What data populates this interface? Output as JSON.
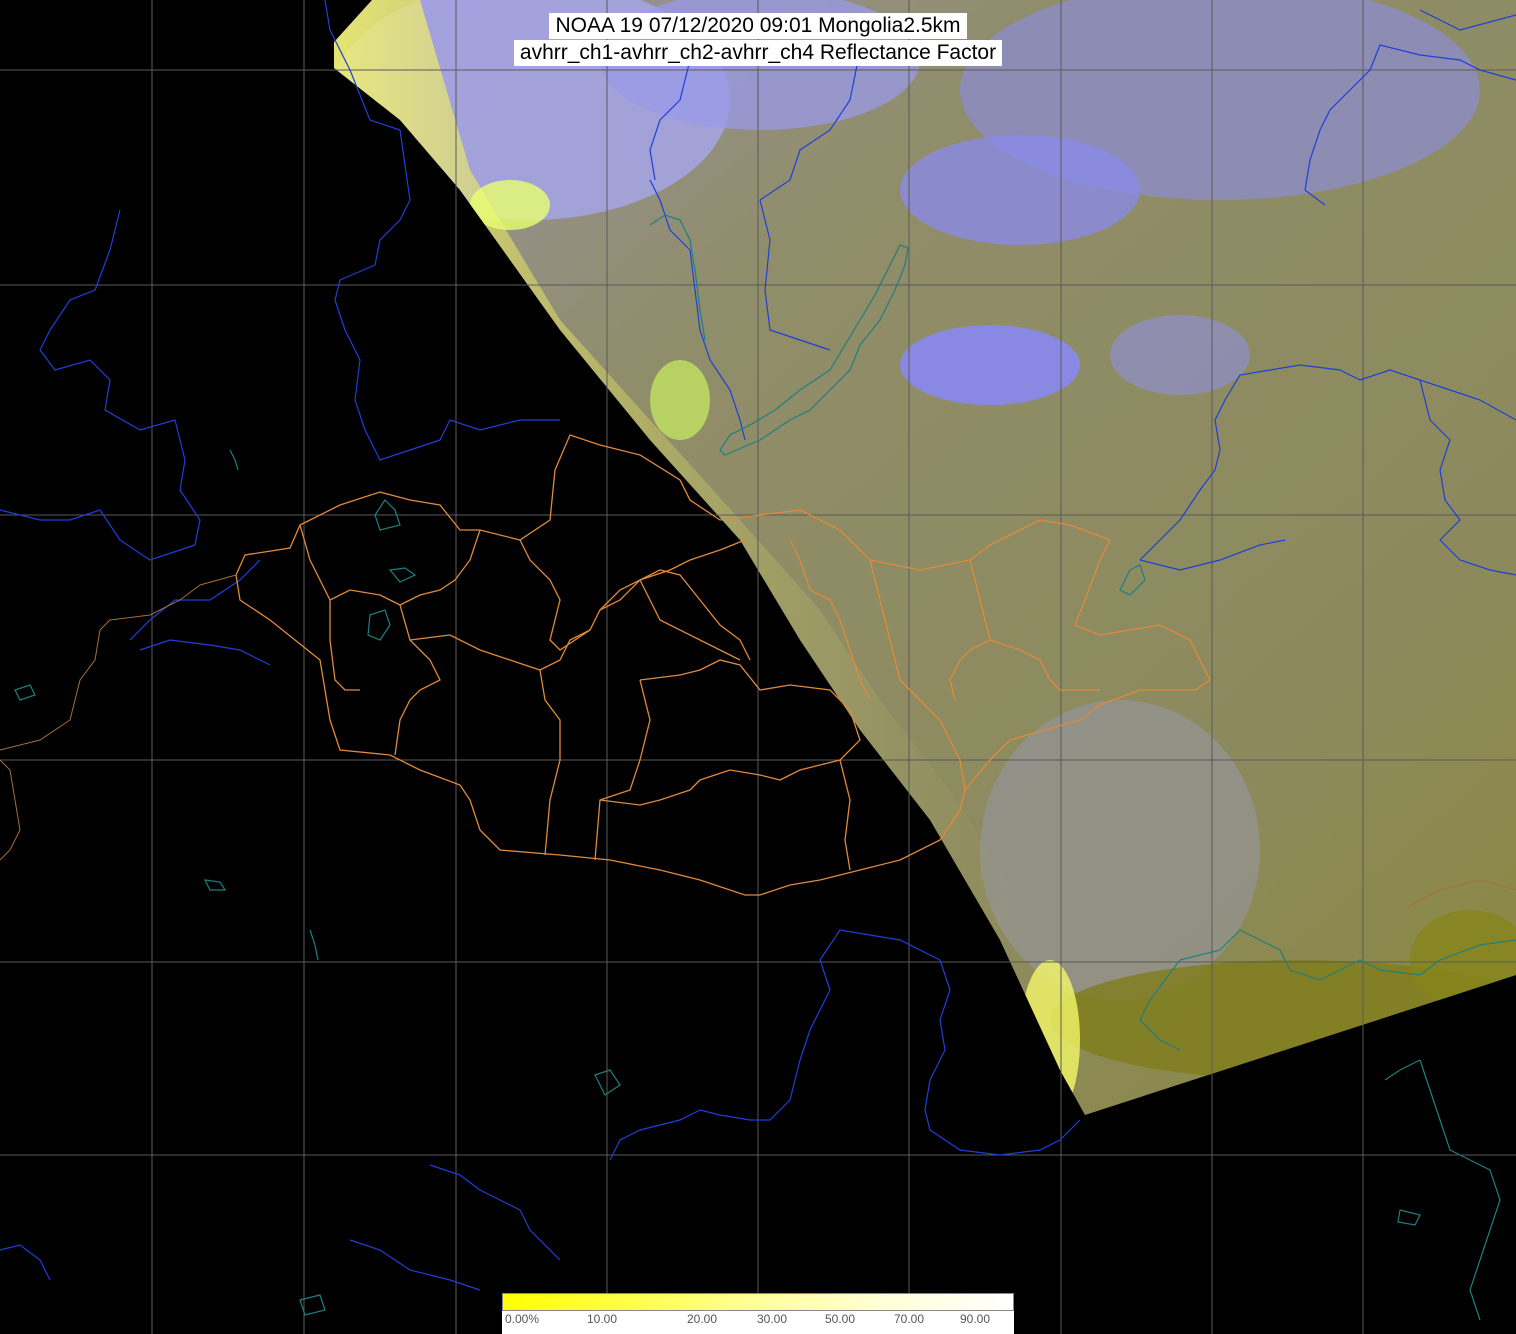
{
  "title": {
    "line1": "NOAA 19 07/12/2020 09:01 Mongolia2.5km",
    "line2": "avhrr_ch1-avhrr_ch2-avhrr_ch4 Reflectance Factor"
  },
  "colorbar": {
    "labels": [
      "0.00%",
      "10.00",
      "20.00",
      "30.00",
      "50.00",
      "70.00",
      "90.00"
    ],
    "colors": [
      "#ffff00",
      "#ffff4a",
      "#ffff9a",
      "#ffffd8",
      "#ffffff"
    ]
  },
  "colors": {
    "grid": "#5a5a5a",
    "rivers": "#1f3fd8",
    "lakes": "#1f7f7f",
    "borders": "#e08a3c",
    "land": "#8e8a5a",
    "clouds": "#8c8ce6",
    "glint": "#f0f040"
  }
}
